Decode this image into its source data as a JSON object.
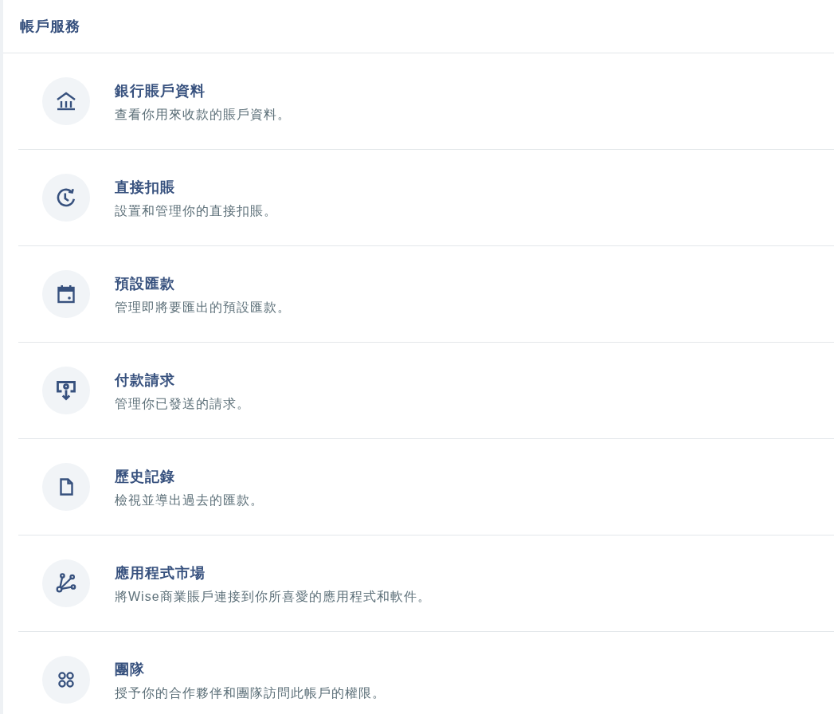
{
  "header": {
    "title": "帳戶服務"
  },
  "items": [
    {
      "kind": "bank",
      "title": "銀行賬戶資料",
      "description": "查看你用來收款的賬戶資料。"
    },
    {
      "kind": "recurring",
      "title": "直接扣賬",
      "description": "設置和管理你的直接扣賬。"
    },
    {
      "kind": "calendar",
      "title": "預設匯款",
      "description": "管理即將要匯出的預設匯款。"
    },
    {
      "kind": "request",
      "title": "付款請求",
      "description": "管理你已發送的請求。"
    },
    {
      "kind": "document",
      "title": "歷史記錄",
      "description": "檢視並導出過去的匯款。"
    },
    {
      "kind": "integrations",
      "title": "應用程式市場",
      "description": "將Wise商業賬戶連接到你所喜愛的應用程式和軟件。"
    },
    {
      "kind": "team",
      "title": "團隊",
      "description": "授予你的合作夥伴和團隊訪問此帳戶的權限。"
    }
  ]
}
